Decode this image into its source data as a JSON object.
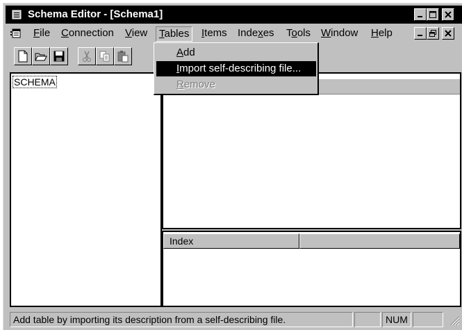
{
  "window": {
    "title": "Schema Editor - [Schema1]"
  },
  "menu": [
    {
      "label": "File",
      "key": "F",
      "rest": "ile"
    },
    {
      "label": "Connection",
      "key": "C",
      "rest": "onnection"
    },
    {
      "label": "View",
      "key": "V",
      "rest": "iew"
    },
    {
      "label": "Tables",
      "key": "T",
      "rest": "ables"
    },
    {
      "label": "Items",
      "key": "I",
      "rest": "tems"
    },
    {
      "label": "Indexes",
      "pre": "Inde",
      "key": "x",
      "rest": "es"
    },
    {
      "label": "Tools",
      "pre": "T",
      "key": "o",
      "rest": "ols"
    },
    {
      "label": "Window",
      "key": "W",
      "rest": "indow"
    },
    {
      "label": "Help",
      "key": "H",
      "rest": "elp"
    }
  ],
  "tables_menu": {
    "items": [
      {
        "label": "Add",
        "key": "A",
        "rest": "dd",
        "state": "normal"
      },
      {
        "label": "Import self-describing file...",
        "key": "I",
        "rest": "mport self-describing file...",
        "state": "highlighted"
      },
      {
        "label": "Remove",
        "key": "R",
        "rest": "emove",
        "state": "disabled"
      }
    ]
  },
  "tree": {
    "root": "SCHEMA"
  },
  "index_pane": {
    "columns": [
      "Index",
      ""
    ]
  },
  "status": {
    "message": "Add table by importing its description from a self-describing file.",
    "num": "NUM"
  },
  "icons": [
    "app-icon",
    "doc-icon",
    "new-file-icon",
    "open-folder-icon",
    "save-icon",
    "cut-icon",
    "copy-icon",
    "paste-icon"
  ]
}
